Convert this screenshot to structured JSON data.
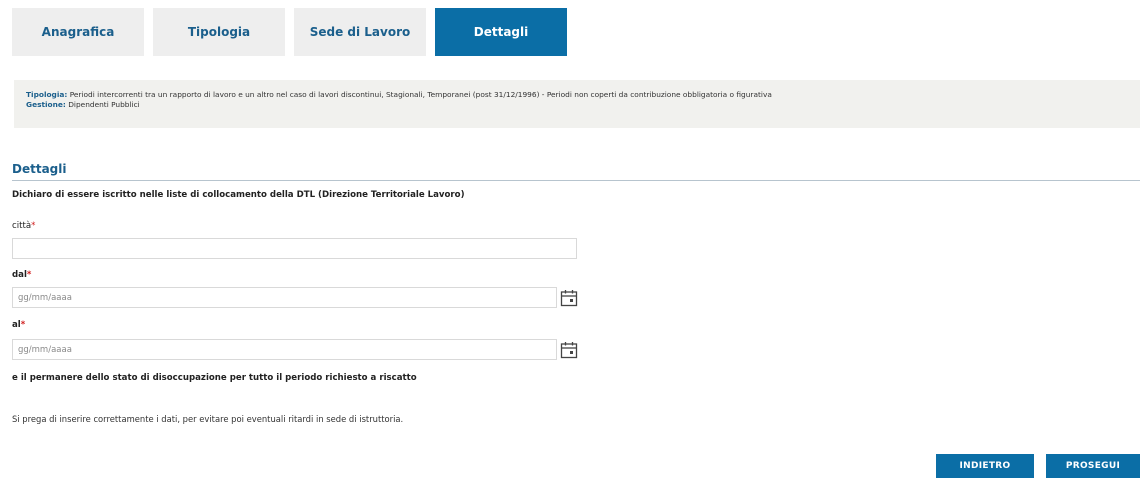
{
  "tabs": [
    {
      "label": "Anagrafica",
      "active": false
    },
    {
      "label": "Tipologia",
      "active": false
    },
    {
      "label": "Sede di Lavoro",
      "active": false
    },
    {
      "label": "Dettagli",
      "active": true
    }
  ],
  "info": {
    "tipologia_label": "Tipologia:",
    "tipologia_value": "Periodi intercorrenti tra un rapporto di lavoro e un altro nel caso di lavori discontinui, Stagionali, Temporanei (post 31/12/1996) - Periodi non coperti da contribuzione obbligatoria o figurativa",
    "gestione_label": "Gestione:",
    "gestione_value": "Dipendenti Pubblici"
  },
  "section": {
    "title": "Dettagli",
    "declaration": "Dichiaro di essere iscritto nelle liste di collocamento della DTL (Direzione Territoriale Lavoro)"
  },
  "form": {
    "city_label": "città",
    "city_value": "",
    "from_label": "dal",
    "from_placeholder": "gg/mm/aaaa",
    "to_label": "al",
    "to_placeholder": "gg/mm/aaaa",
    "required_mark": "*",
    "permanence": "e il permanere dello stato di disoccupazione per tutto il periodo richiesto a riscatto",
    "note": "Si prega di inserire correttamente i dati, per evitare poi eventuali ritardi in sede di istruttoria."
  },
  "buttons": {
    "back": "INDIETRO",
    "next": "PROSEGUI"
  },
  "colors": {
    "accent": "#0b6ea6",
    "tab_text": "#1b5f8c",
    "required": "#d02020"
  }
}
